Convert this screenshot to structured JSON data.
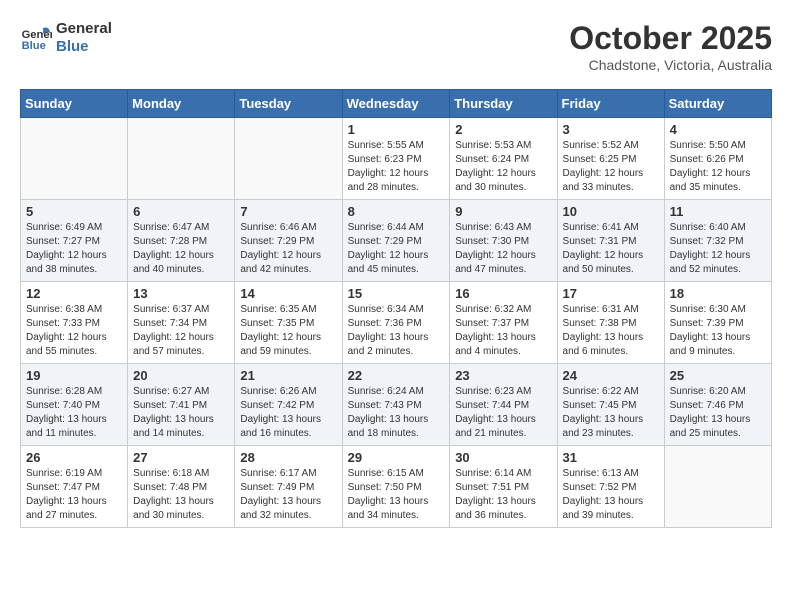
{
  "logo": {
    "line1": "General",
    "line2": "Blue"
  },
  "title": "October 2025",
  "subtitle": "Chadstone, Victoria, Australia",
  "days_of_week": [
    "Sunday",
    "Monday",
    "Tuesday",
    "Wednesday",
    "Thursday",
    "Friday",
    "Saturday"
  ],
  "weeks": [
    [
      {
        "day": "",
        "content": ""
      },
      {
        "day": "",
        "content": ""
      },
      {
        "day": "",
        "content": ""
      },
      {
        "day": "1",
        "content": "Sunrise: 5:55 AM\nSunset: 6:23 PM\nDaylight: 12 hours\nand 28 minutes."
      },
      {
        "day": "2",
        "content": "Sunrise: 5:53 AM\nSunset: 6:24 PM\nDaylight: 12 hours\nand 30 minutes."
      },
      {
        "day": "3",
        "content": "Sunrise: 5:52 AM\nSunset: 6:25 PM\nDaylight: 12 hours\nand 33 minutes."
      },
      {
        "day": "4",
        "content": "Sunrise: 5:50 AM\nSunset: 6:26 PM\nDaylight: 12 hours\nand 35 minutes."
      }
    ],
    [
      {
        "day": "5",
        "content": "Sunrise: 6:49 AM\nSunset: 7:27 PM\nDaylight: 12 hours\nand 38 minutes."
      },
      {
        "day": "6",
        "content": "Sunrise: 6:47 AM\nSunset: 7:28 PM\nDaylight: 12 hours\nand 40 minutes."
      },
      {
        "day": "7",
        "content": "Sunrise: 6:46 AM\nSunset: 7:29 PM\nDaylight: 12 hours\nand 42 minutes."
      },
      {
        "day": "8",
        "content": "Sunrise: 6:44 AM\nSunset: 7:29 PM\nDaylight: 12 hours\nand 45 minutes."
      },
      {
        "day": "9",
        "content": "Sunrise: 6:43 AM\nSunset: 7:30 PM\nDaylight: 12 hours\nand 47 minutes."
      },
      {
        "day": "10",
        "content": "Sunrise: 6:41 AM\nSunset: 7:31 PM\nDaylight: 12 hours\nand 50 minutes."
      },
      {
        "day": "11",
        "content": "Sunrise: 6:40 AM\nSunset: 7:32 PM\nDaylight: 12 hours\nand 52 minutes."
      }
    ],
    [
      {
        "day": "12",
        "content": "Sunrise: 6:38 AM\nSunset: 7:33 PM\nDaylight: 12 hours\nand 55 minutes."
      },
      {
        "day": "13",
        "content": "Sunrise: 6:37 AM\nSunset: 7:34 PM\nDaylight: 12 hours\nand 57 minutes."
      },
      {
        "day": "14",
        "content": "Sunrise: 6:35 AM\nSunset: 7:35 PM\nDaylight: 12 hours\nand 59 minutes."
      },
      {
        "day": "15",
        "content": "Sunrise: 6:34 AM\nSunset: 7:36 PM\nDaylight: 13 hours\nand 2 minutes."
      },
      {
        "day": "16",
        "content": "Sunrise: 6:32 AM\nSunset: 7:37 PM\nDaylight: 13 hours\nand 4 minutes."
      },
      {
        "day": "17",
        "content": "Sunrise: 6:31 AM\nSunset: 7:38 PM\nDaylight: 13 hours\nand 6 minutes."
      },
      {
        "day": "18",
        "content": "Sunrise: 6:30 AM\nSunset: 7:39 PM\nDaylight: 13 hours\nand 9 minutes."
      }
    ],
    [
      {
        "day": "19",
        "content": "Sunrise: 6:28 AM\nSunset: 7:40 PM\nDaylight: 13 hours\nand 11 minutes."
      },
      {
        "day": "20",
        "content": "Sunrise: 6:27 AM\nSunset: 7:41 PM\nDaylight: 13 hours\nand 14 minutes."
      },
      {
        "day": "21",
        "content": "Sunrise: 6:26 AM\nSunset: 7:42 PM\nDaylight: 13 hours\nand 16 minutes."
      },
      {
        "day": "22",
        "content": "Sunrise: 6:24 AM\nSunset: 7:43 PM\nDaylight: 13 hours\nand 18 minutes."
      },
      {
        "day": "23",
        "content": "Sunrise: 6:23 AM\nSunset: 7:44 PM\nDaylight: 13 hours\nand 21 minutes."
      },
      {
        "day": "24",
        "content": "Sunrise: 6:22 AM\nSunset: 7:45 PM\nDaylight: 13 hours\nand 23 minutes."
      },
      {
        "day": "25",
        "content": "Sunrise: 6:20 AM\nSunset: 7:46 PM\nDaylight: 13 hours\nand 25 minutes."
      }
    ],
    [
      {
        "day": "26",
        "content": "Sunrise: 6:19 AM\nSunset: 7:47 PM\nDaylight: 13 hours\nand 27 minutes."
      },
      {
        "day": "27",
        "content": "Sunrise: 6:18 AM\nSunset: 7:48 PM\nDaylight: 13 hours\nand 30 minutes."
      },
      {
        "day": "28",
        "content": "Sunrise: 6:17 AM\nSunset: 7:49 PM\nDaylight: 13 hours\nand 32 minutes."
      },
      {
        "day": "29",
        "content": "Sunrise: 6:15 AM\nSunset: 7:50 PM\nDaylight: 13 hours\nand 34 minutes."
      },
      {
        "day": "30",
        "content": "Sunrise: 6:14 AM\nSunset: 7:51 PM\nDaylight: 13 hours\nand 36 minutes."
      },
      {
        "day": "31",
        "content": "Sunrise: 6:13 AM\nSunset: 7:52 PM\nDaylight: 13 hours\nand 39 minutes."
      },
      {
        "day": "",
        "content": ""
      }
    ]
  ]
}
